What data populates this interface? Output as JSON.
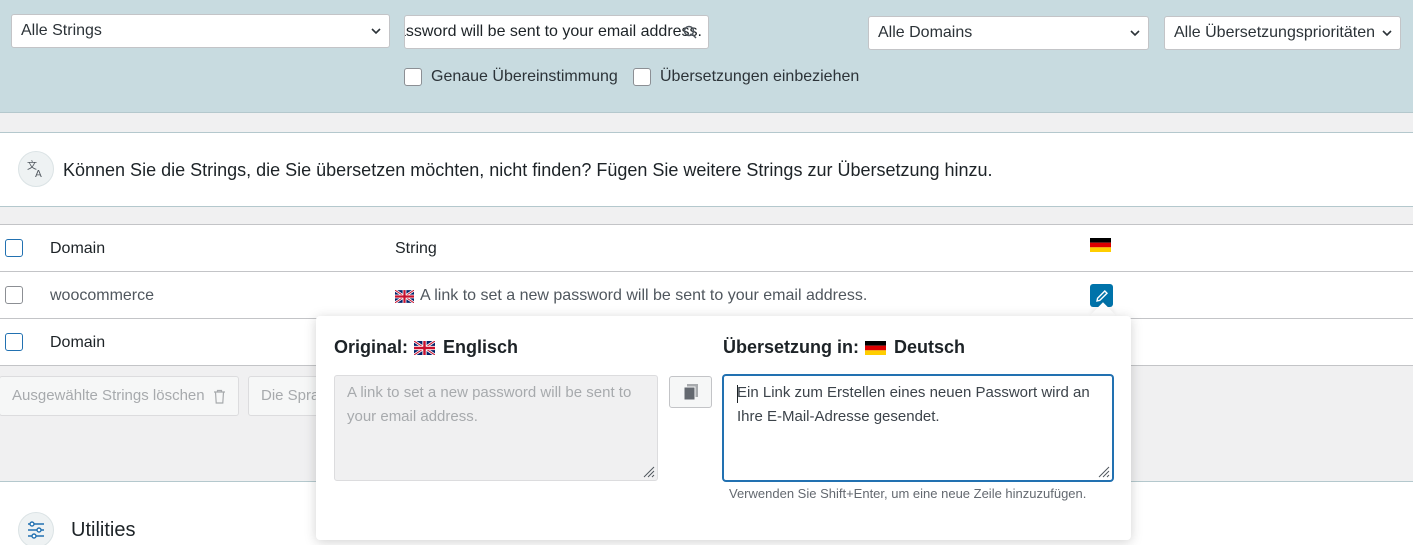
{
  "filters": {
    "string_type": "Alle Strings",
    "search_value": "A link to set a new password will be sent to your email address.",
    "domains": "Alle Domains",
    "priorities": "Alle Übersetzungsprioritäten",
    "exact_match_label": "Genaue Übereinstimmung",
    "include_translations_label": "Übersetzungen einbeziehen"
  },
  "notice": {
    "text": "Können Sie die Strings, die Sie übersetzen möchten, nicht finden? Fügen Sie weitere Strings zur Übersetzung hinzu."
  },
  "table": {
    "header": {
      "domain": "Domain",
      "string": "String",
      "lang_flag": "de"
    },
    "rows": [
      {
        "domain": "woocommerce",
        "string": "A link to set a new password will be sent to your email address.",
        "source_flag": "gb"
      }
    ],
    "footer": {
      "domain": "Domain"
    }
  },
  "bulk_actions": {
    "delete_label": "Ausgewählte Strings löschen",
    "language_label": "Die Spra"
  },
  "utilities": {
    "title": "Utilities"
  },
  "popup": {
    "original_label": "Original:",
    "original_lang": "Englisch",
    "original_text": "A link to set a new password will be sent to your email address.",
    "translation_label": "Übersetzung in:",
    "translation_lang": "Deutsch",
    "translation_text": "Ein Link zum Erstellen eines neuen Passwort wird an Ihre E-Mail-Adresse gesendet.",
    "hint": "Verwenden Sie Shift+Enter, um eine neue Zeile hinzuzufügen."
  },
  "colors": {
    "accent": "#0073aa",
    "filter_bg": "#c8dbe0",
    "focus": "#2271b1"
  },
  "icons": [
    "chevron-down-icon",
    "search-icon",
    "translate-icon",
    "uk-flag-icon",
    "de-flag-icon",
    "pencil-icon",
    "trash-icon",
    "copy-icon",
    "sliders-icon",
    "resize-handle-icon"
  ]
}
